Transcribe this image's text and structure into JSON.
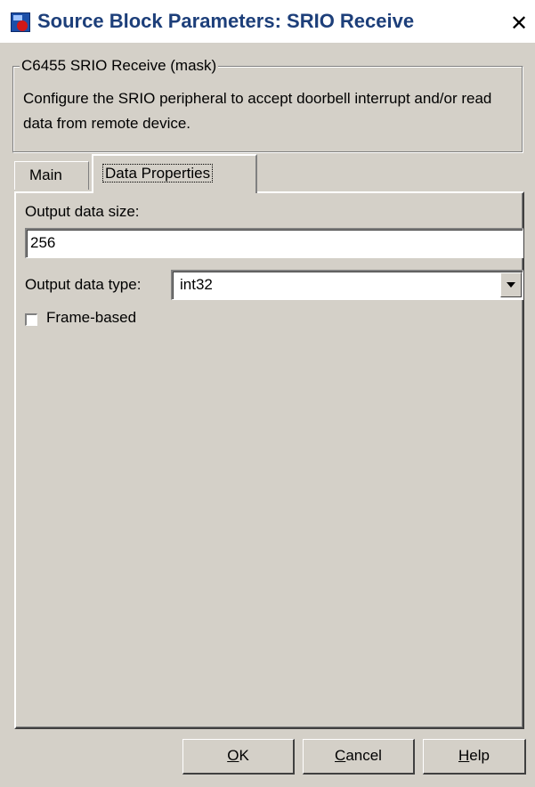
{
  "window": {
    "title": "Source Block Parameters: SRIO Receive",
    "close_glyph": "✕",
    "app_icon": "simulink-block-icon"
  },
  "mask": {
    "group_title": "C6455 SRIO Receive (mask)",
    "description": "Configure the SRIO peripheral to accept doorbell interrupt and/or read data from remote device."
  },
  "tabs": [
    {
      "label": "Main",
      "selected": false
    },
    {
      "label": "Data Properties",
      "selected": true
    }
  ],
  "form": {
    "output_size_label": "Output data size:",
    "output_size_value": "256",
    "output_type_label": "Output data type:",
    "output_type_value": "int32",
    "frame_based_label": "Frame-based",
    "frame_based_checked": false
  },
  "buttons": {
    "ok": {
      "mnemonic": "O",
      "rest": "K"
    },
    "cancel": {
      "mnemonic": "C",
      "rest": "ancel"
    },
    "help": {
      "mnemonic": "H",
      "rest": "elp"
    }
  }
}
